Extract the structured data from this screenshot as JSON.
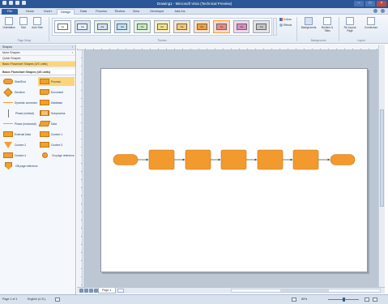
{
  "window": {
    "title": "Drawing1 - Microsoft Visio (Technical Preview)"
  },
  "tabs": [
    "File",
    "Home",
    "Insert",
    "Design",
    "Data",
    "Process",
    "Review",
    "View",
    "Developer",
    "Add-Ins"
  ],
  "active_tab": "Design",
  "ribbon": {
    "page_setup": {
      "orientation": "Orientation",
      "size": "Size",
      "auto_size": "Auto Size",
      "label": "Page Setup"
    },
    "themes": {
      "label": "Themes",
      "swatch_text": "Aa",
      "count": 11,
      "selected_index": 8
    },
    "colors_label": "Colors",
    "effects_label": "Effects",
    "backgrounds": {
      "background": "Backgrounds",
      "borders": "Borders & Titles",
      "label": "Backgrounds"
    },
    "layout": {
      "relayout": "Re-Layout Page",
      "connectors": "Connectors",
      "label": "Layout"
    }
  },
  "shapes_panel": {
    "header": "Shapes",
    "more_shapes": "More Shapes",
    "quick_shapes": "Quick Shapes",
    "active_stencil": "Basic Flowchart Shapes (US units)",
    "stencil_title": "Basic Flowchart Shapes (US units)",
    "items": [
      {
        "label": "Start/End",
        "icon": "pill"
      },
      {
        "label": "Process",
        "icon": "rect"
      },
      {
        "label": "Decision",
        "icon": "diamond"
      },
      {
        "label": "Document",
        "icon": "doc"
      },
      {
        "label": "Dynamic connector",
        "icon": "line"
      },
      {
        "label": "Database",
        "icon": "rect"
      },
      {
        "label": "Phase (vertical)",
        "icon": "vline"
      },
      {
        "label": "Subprocess",
        "icon": "dbl"
      },
      {
        "label": "Phase (horizontal)",
        "icon": "line"
      },
      {
        "label": "Data",
        "icon": "para"
      },
      {
        "label": "External Data",
        "icon": "rect"
      },
      {
        "label": "Custom 1",
        "icon": "rect"
      },
      {
        "label": "Custom 2",
        "icon": "tri"
      },
      {
        "label": "Custom 3",
        "icon": "rect"
      },
      {
        "label": "Custom 4",
        "icon": "rect"
      },
      {
        "label": "On-page reference",
        "icon": "circle"
      },
      {
        "label": "Off-page reference",
        "icon": "offpage"
      }
    ],
    "highlighted_item": "Process"
  },
  "page_tabs": {
    "page": "Page-1"
  },
  "status": {
    "page": "Page 1 of 1",
    "language": "English (U.S.)",
    "zoom": "80%"
  },
  "flowchart": {
    "shape_color": "#f39a2e",
    "shape_border": "#c97614",
    "connector_color": "#404040",
    "shapes": [
      "start-end",
      "process",
      "process",
      "process",
      "process",
      "process",
      "start-end"
    ]
  }
}
